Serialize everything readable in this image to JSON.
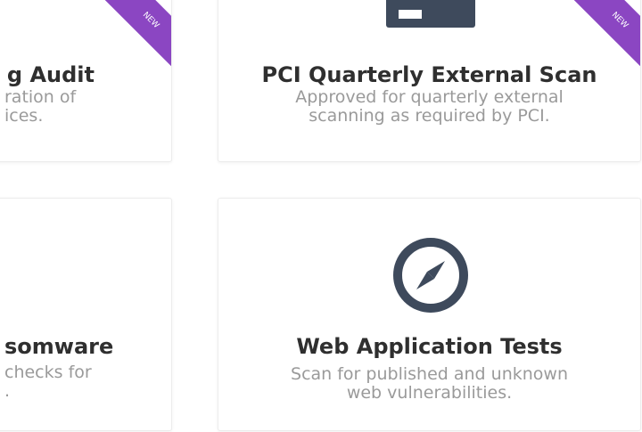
{
  "cards": [
    {
      "title": "g Audit",
      "desc_line1": "ration of",
      "desc_line2": "ices.",
      "ribbon": "NEW"
    },
    {
      "title": "PCI Quarterly External Scan",
      "desc_line1": "Approved for quarterly external",
      "desc_line2": "scanning as required by PCI.",
      "ribbon": "NEW"
    },
    {
      "title": "somware",
      "desc_line1": "checks for",
      "desc_line2": "."
    },
    {
      "title": "Web Application Tests",
      "desc_line1": "Scan for published and unknown",
      "desc_line2": "web vulnerabilities."
    }
  ],
  "colors": {
    "ribbon": "#8b46c2",
    "icon": "#3e4a5c",
    "title": "#2f2f2f",
    "desc": "#9a9a9a"
  },
  "icons": {
    "card2_top_icon": "terminal-icon",
    "card4_icon": "compass-icon"
  }
}
